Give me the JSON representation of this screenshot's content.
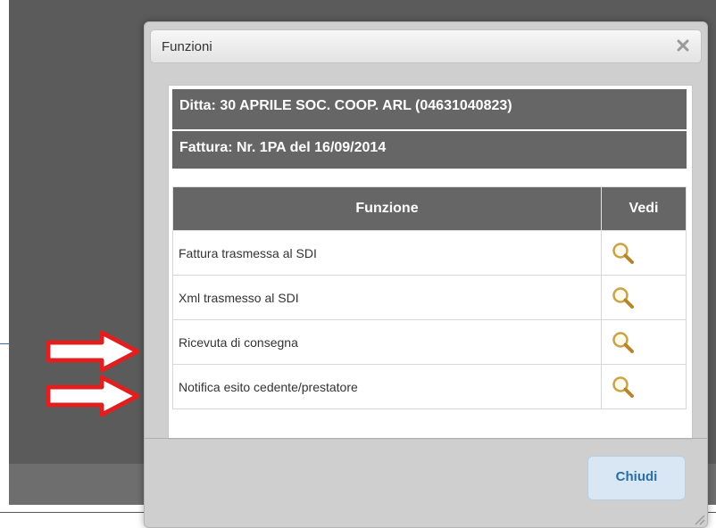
{
  "dialog": {
    "title": "Funzioni",
    "ditta": "Ditta: 30 APRILE SOC. COOP. ARL (04631040823)",
    "fattura": "Fattura: Nr. 1PA del 16/09/2014",
    "table": {
      "headers": [
        "Funzione",
        "Vedi"
      ],
      "rows": [
        {
          "funzione": "Fattura trasmessa al SDI"
        },
        {
          "funzione": "Xml trasmesso al SDI"
        },
        {
          "funzione": "Ricevuta di consegna"
        },
        {
          "funzione": "Notifica esito cedente/prestatore"
        }
      ]
    },
    "close_button": "Chiudi"
  },
  "icons": {
    "close": "close-icon",
    "view": "magnifier-icon",
    "resize": "resize-grip-icon",
    "annotation": "red-arrow-icon"
  },
  "colors": {
    "header_bg": "#666666",
    "accent_button": "#2a6ea8",
    "arrow": "#e02020"
  }
}
